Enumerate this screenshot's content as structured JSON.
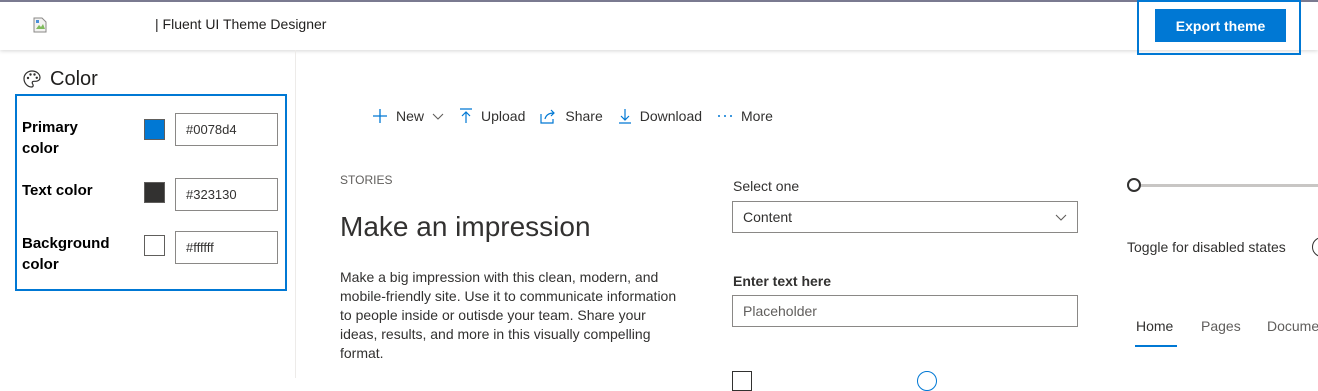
{
  "header": {
    "title": "| Fluent UI Theme Designer",
    "export_label": "Export theme"
  },
  "sidebar": {
    "section_title": "Color",
    "colors": [
      {
        "label_line1": "Primary",
        "label_line2": "color",
        "swatch": "#0078d4",
        "value": "#0078d4"
      },
      {
        "label_line1": "Text color",
        "label_line2": "",
        "swatch": "#323130",
        "value": "#323130"
      },
      {
        "label_line1": "Background",
        "label_line2": "color",
        "swatch": "#ffffff",
        "value": "#ffffff"
      }
    ]
  },
  "commandbar": {
    "new": "New",
    "upload": "Upload",
    "share": "Share",
    "download": "Download",
    "more": "More"
  },
  "story": {
    "eyebrow": "STORIES",
    "headline": "Make an impression",
    "body": "Make a big impression with this clean, modern, and mobile-friendly site. Use it to communicate information to people inside or outisde your team. Share your ideas, results, and more in this visually compelling format."
  },
  "form": {
    "select_label": "Select one",
    "select_value": "Content",
    "text_label": "Enter text here",
    "text_placeholder": "Placeholder"
  },
  "controls": {
    "toggle_label": "Toggle for disabled states",
    "pivots": [
      "Home",
      "Pages",
      "Docume"
    ]
  },
  "colors": {
    "accent": "#0078d4",
    "text": "#323130"
  }
}
